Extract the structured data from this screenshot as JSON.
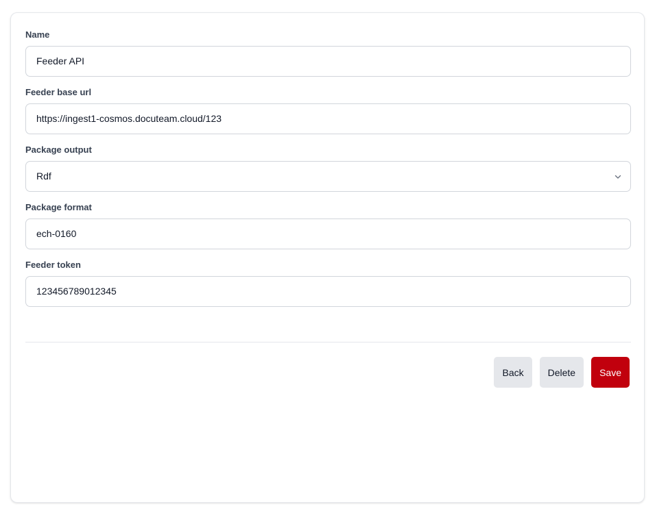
{
  "form": {
    "fields": [
      {
        "label": "Name",
        "value": "Feeder API"
      },
      {
        "label": "Feeder base url",
        "value": "https://ingest1-cosmos.docuteam.cloud/123"
      },
      {
        "label": "Package output",
        "value": "Rdf"
      },
      {
        "label": "Package format",
        "value": "ech-0160"
      },
      {
        "label": "Feeder token",
        "value": "123456789012345"
      }
    ]
  },
  "actions": {
    "back_label": "Back",
    "delete_label": "Delete",
    "save_label": "Save"
  },
  "icons": {
    "select_chevron": "chevron-down-icon"
  },
  "colors": {
    "primary": "#c1000d",
    "secondary": "#e5e7eb"
  }
}
